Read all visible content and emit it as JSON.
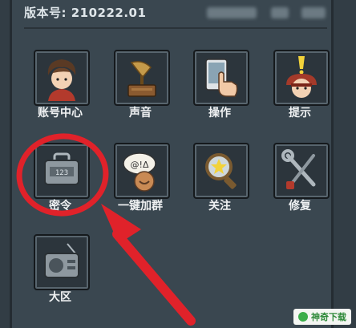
{
  "header": {
    "version_text": "版本号: 210222.01"
  },
  "menu": {
    "items": [
      {
        "label": "账号中心",
        "icon": "character-portrait-icon"
      },
      {
        "label": "声音",
        "icon": "gramophone-icon"
      },
      {
        "label": "操作",
        "icon": "hand-tap-icon"
      },
      {
        "label": "提示",
        "icon": "warning-helmet-icon"
      },
      {
        "label": "密令",
        "icon": "password-box-icon"
      },
      {
        "label": "一键加群",
        "icon": "chat-group-icon"
      },
      {
        "label": "关注",
        "icon": "magnifier-star-icon"
      },
      {
        "label": "修复",
        "icon": "wrench-tools-icon"
      },
      {
        "label": "大区",
        "icon": "radio-icon"
      }
    ]
  },
  "annotation": {
    "color": "#e0222a"
  },
  "watermark": {
    "text": "神奇下载"
  }
}
